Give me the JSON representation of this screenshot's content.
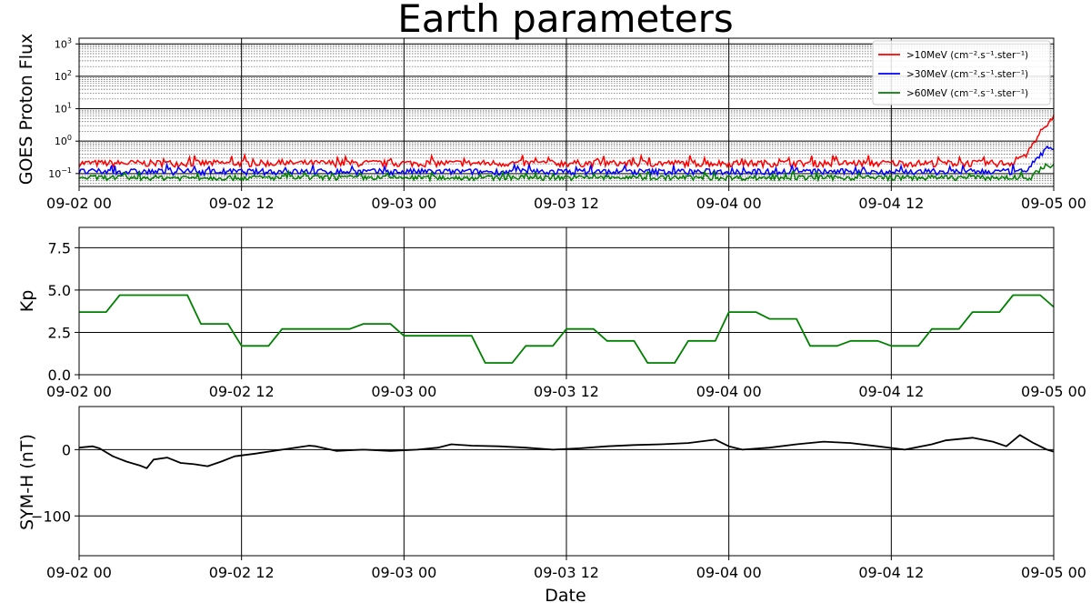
{
  "figure": {
    "title": "Earth parameters",
    "xlabel": "Date"
  },
  "chart_data": [
    {
      "type": "line",
      "panel": "goes",
      "ylabel": "GOES Proton Flux",
      "yscale": "log",
      "ylim": [
        0.04,
        1500
      ],
      "xlim_hours": [
        0,
        72
      ],
      "x_ticks": [
        "09-02 00",
        "09-02 12",
        "09-03 00",
        "09-03 12",
        "09-04 00",
        "09-04 12",
        "09-05 00"
      ],
      "y_ticks": [
        {
          "value": 0.1,
          "base": "10",
          "exp": "−1"
        },
        {
          "value": 1,
          "base": "10",
          "exp": "0"
        },
        {
          "value": 10,
          "base": "10",
          "exp": "1"
        },
        {
          "value": 100,
          "base": "10",
          "exp": "2"
        },
        {
          "value": 1000,
          "base": "10",
          "exp": "3"
        }
      ],
      "grid": "major and minor",
      "legend_position": "upper right",
      "series": [
        {
          "name": ">10MeV (cm⁻².s⁻¹.ster⁻¹)",
          "color": "#ff0000",
          "baseline": 0.21,
          "noise": 0.05,
          "ending": [
            [
              69.0,
              0.25
            ],
            [
              70.0,
              0.4
            ],
            [
              70.6,
              1.0
            ],
            [
              71.2,
              2.5
            ],
            [
              72.0,
              5.5
            ]
          ]
        },
        {
          "name": ">30MeV (cm⁻².s⁻¹.ster⁻¹)",
          "color": "#0000ff",
          "baseline": 0.115,
          "noise": 0.025,
          "ending": [
            [
              70.0,
              0.13
            ],
            [
              70.8,
              0.3
            ],
            [
              71.5,
              0.6
            ],
            [
              72.0,
              0.5
            ]
          ]
        },
        {
          "name": ">60MeV (cm⁻².s⁻¹.ster⁻¹)",
          "color": "#008000",
          "baseline": 0.075,
          "noise": 0.013,
          "ending": [
            [
              70.5,
              0.09
            ],
            [
              71.3,
              0.17
            ],
            [
              72.0,
              0.18
            ]
          ]
        }
      ]
    },
    {
      "type": "line",
      "panel": "kp",
      "ylabel": "Kp",
      "ylim": [
        0,
        8.7
      ],
      "xlim_hours": [
        0,
        72
      ],
      "x_ticks": [
        "09-02 00",
        "09-02 12",
        "09-03 00",
        "09-03 12",
        "09-04 00",
        "09-04 12",
        "09-05 00"
      ],
      "y_ticks": [
        "0.0",
        "2.5",
        "5.0",
        "7.5"
      ],
      "y_tick_values": [
        0,
        2.5,
        5,
        7.5
      ],
      "grid": true,
      "series": [
        {
          "name": "",
          "color": "#008000",
          "x_hours": [
            0,
            2,
            3,
            8,
            9,
            11,
            12,
            14,
            15,
            20,
            21,
            23,
            24,
            29,
            30,
            32,
            33,
            35,
            36,
            38,
            39,
            41,
            42,
            44,
            45,
            47,
            48,
            50,
            51,
            53,
            54,
            56,
            57,
            59,
            60,
            62,
            63,
            65,
            66,
            68,
            69,
            71,
            72
          ],
          "y": [
            3.7,
            3.7,
            4.7,
            4.7,
            3.0,
            3.0,
            1.7,
            1.7,
            2.7,
            2.7,
            3.0,
            3.0,
            2.3,
            2.3,
            0.7,
            0.7,
            1.7,
            1.7,
            2.7,
            2.7,
            2.0,
            2.0,
            0.7,
            0.7,
            2.0,
            2.0,
            3.7,
            3.7,
            3.3,
            3.3,
            1.7,
            1.7,
            2.0,
            2.0,
            1.7,
            1.7,
            2.7,
            2.7,
            3.7,
            3.7,
            4.7,
            4.7,
            4.0
          ]
        }
      ]
    },
    {
      "type": "line",
      "panel": "symh",
      "ylabel": "SYM-H (nT)",
      "ylim": [
        -160,
        65
      ],
      "xlim_hours": [
        0,
        72
      ],
      "x_ticks": [
        "09-02 00",
        "09-02 12",
        "09-03 00",
        "09-03 12",
        "09-04 00",
        "09-04 12",
        "09-05 00"
      ],
      "y_ticks": [
        "−100",
        "0"
      ],
      "y_tick_values": [
        -100,
        0
      ],
      "grid": true,
      "series": [
        {
          "name": "",
          "color": "#000000",
          "x_hours": [
            0,
            1,
            1.5,
            2.5,
            3.5,
            4.5,
            5,
            5.5,
            6.5,
            7.5,
            8.5,
            9.5,
            10.5,
            11.5,
            13,
            15,
            17,
            17.5,
            19,
            21,
            23,
            25,
            26.5,
            27.5,
            29,
            31,
            33,
            35,
            37,
            39,
            41,
            43,
            45,
            47,
            48,
            49,
            51,
            53,
            55,
            57,
            59,
            61,
            63,
            64,
            66,
            67.5,
            68.5,
            69.5,
            70.5,
            71.5,
            72
          ],
          "y": [
            3,
            5,
            2,
            -10,
            -18,
            -24,
            -28,
            -15,
            -12,
            -20,
            -22,
            -25,
            -18,
            -10,
            -6,
            0,
            6,
            5,
            -2,
            0,
            -2,
            0,
            3,
            8,
            6,
            5,
            3,
            0,
            2,
            5,
            7,
            8,
            10,
            15,
            5,
            0,
            3,
            8,
            12,
            10,
            5,
            0,
            8,
            14,
            18,
            12,
            5,
            22,
            10,
            0,
            -3
          ]
        }
      ]
    }
  ]
}
